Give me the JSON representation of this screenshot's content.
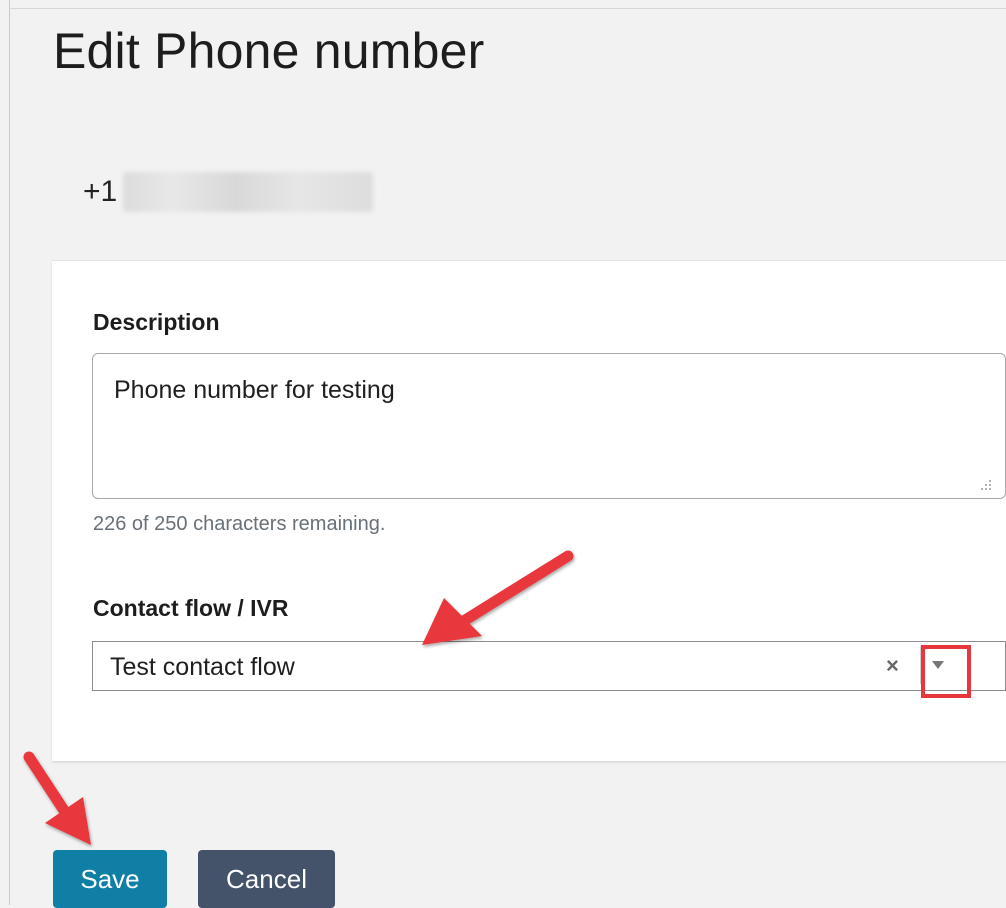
{
  "page": {
    "title": "Edit Phone number",
    "phone_prefix": "+1"
  },
  "description": {
    "label": "Description",
    "value": "Phone number for testing",
    "char_count": "226 of 250 characters remaining."
  },
  "contact_flow": {
    "label": "Contact flow / IVR",
    "selected": "Test contact flow",
    "clear_glyph": "×"
  },
  "actions": {
    "save_label": "Save",
    "cancel_label": "Cancel"
  },
  "colors": {
    "save_button": "#0f7fa6",
    "cancel_button": "#45536a",
    "annotation_red": "#e8373c"
  },
  "icons": {
    "clear": "close-icon",
    "dropdown": "chevron-down-icon",
    "resize": "resize-grip-icon",
    "annotation": "arrow-icon"
  }
}
